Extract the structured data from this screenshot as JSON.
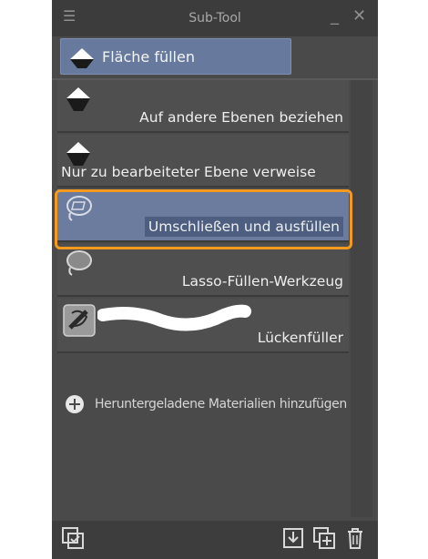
{
  "window": {
    "title": "Sub-Tool",
    "menu_icon": "hamburger-menu-icon",
    "minimize_icon": "minimize-icon",
    "close_icon": "close-icon"
  },
  "tab": {
    "label": "Fläche füllen",
    "icon": "paint-bucket-icon"
  },
  "items": [
    {
      "label": "Auf andere Ebenen beziehen",
      "icon": "paint-bucket-icon",
      "selected": false
    },
    {
      "label": "Nur zu bearbeiteter Ebene verweise",
      "icon": "paint-bucket-icon",
      "selected": false
    },
    {
      "label": "Umschließen und ausfüllen",
      "icon": "lasso-fill-icon",
      "selected": true
    },
    {
      "label": "Lasso-Füllen-Werkzeug",
      "icon": "lasso-icon",
      "selected": false
    },
    {
      "label": "Lückenfüller",
      "icon": "gap-filler-icon",
      "selected": false
    }
  ],
  "add_materials": {
    "label": "Heruntergeladene Materialien hinzufügen",
    "icon": "plus-circle-icon"
  },
  "footer": {
    "left_icon": "sub-tool-options-icon",
    "right_icons": [
      "import-icon",
      "duplicate-icon",
      "delete-icon"
    ]
  },
  "colors": {
    "accent_highlight": "#f59a1f",
    "selected_bg": "#6b7c9e"
  }
}
